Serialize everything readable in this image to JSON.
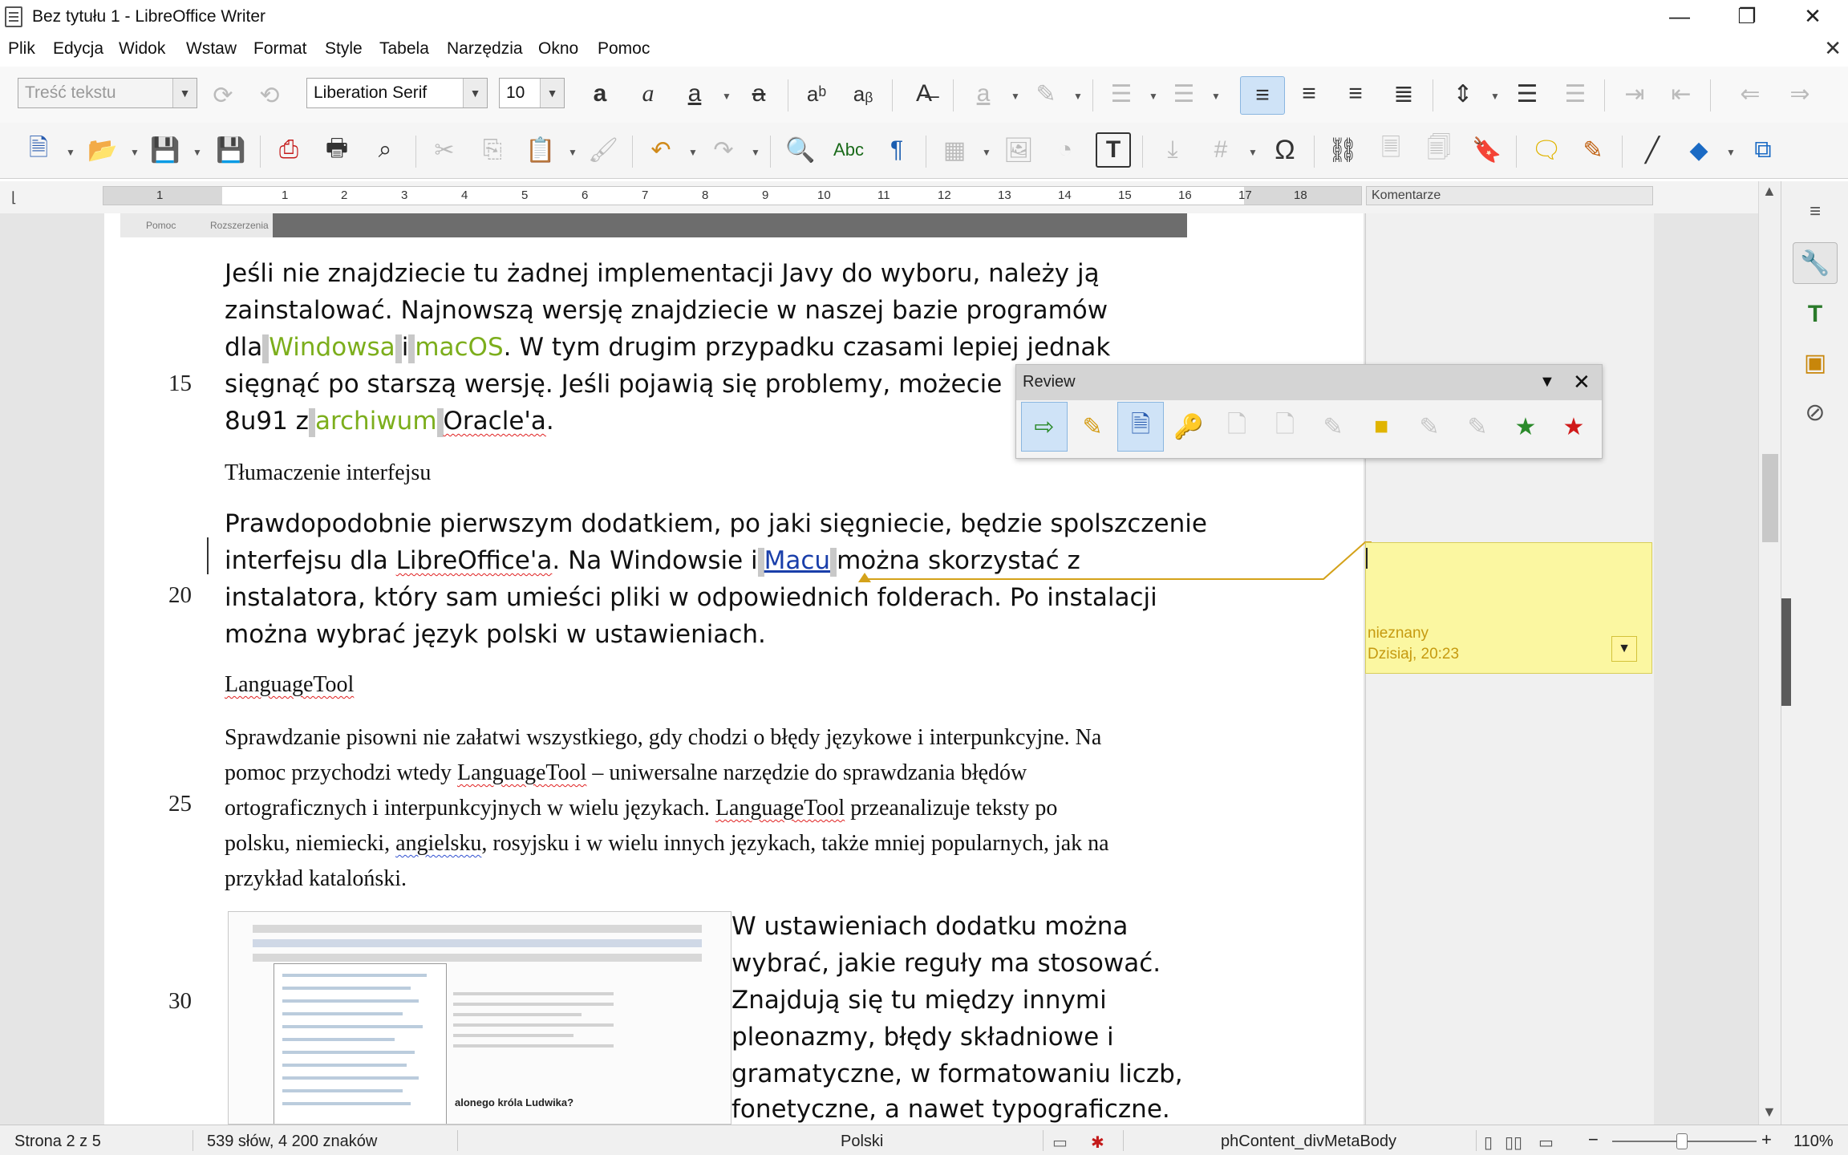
{
  "window": {
    "title": "Bez tytułu 1 - LibreOffice Writer",
    "minimize": "—",
    "restore": "❐",
    "close": "✕"
  },
  "menu": {
    "items": [
      "Plik",
      "Edycja",
      "Widok",
      "Wstaw",
      "Format",
      "Style",
      "Tabela",
      "Narzędzia",
      "Okno",
      "Pomoc"
    ],
    "close_doc": "✕"
  },
  "formatting_toolbar": {
    "paragraph_style": "Treść tekstu",
    "font_name": "Liberation Serif",
    "font_size": "10"
  },
  "ruler": {
    "numbers": [
      "1",
      "1",
      "2",
      "3",
      "4",
      "5",
      "6",
      "7",
      "8",
      "9",
      "10",
      "11",
      "12",
      "13",
      "14",
      "15",
      "16",
      "17",
      "18"
    ],
    "comments_header": "Komentarze"
  },
  "embedded_strip": {
    "tabs": [
      "Pomoc",
      "Rozszerzenia"
    ]
  },
  "document": {
    "line_numbers": [
      "15",
      "20",
      "25",
      "30"
    ],
    "para1": {
      "line1": "Jeśli nie znajdziecie tu żadnej implementacji Javy do wyboru, należy ją",
      "line2": "zainstalować. Najnowszą wersję znajdziecie w naszej bazie programów",
      "line3_a": "dla",
      "line3_link1": "Windowsa",
      "line3_b": "i",
      "line3_link2": "macOS",
      "line3_c": ". W tym drugim przypadku czasami lepiej jednak",
      "line4": "sięgnąć po starszą wersję. Jeśli pojawią się problemy, możecie",
      "line5_a": "8u91 z",
      "line5_link": "archiwum",
      "line5_b": "Oracle'a",
      "line5_c": "."
    },
    "heading1": "Tłumaczenie interfejsu",
    "para2": {
      "line1": "Prawdopodobnie pierwszym dodatkiem, po jaki sięgniecie, będzie spolszczenie",
      "line2_a": "interfejsu dla",
      "line2_spell": "LibreOffice'a",
      "line2_b": ". Na Windowsie i",
      "line2_link": "Macu",
      "line2_c": "można skorzystać z",
      "line3": "instalatora, który sam umieści pliki w odpowiednich folderach. Po instalacji",
      "line4": "można wybrać język polski w ustawieniach."
    },
    "heading2": "LanguageTool",
    "para3": {
      "line1": "Sprawdzanie pisowni nie załatwi wszystkiego, gdy chodzi o błędy językowe i interpunkcyjne. Na",
      "line2_a": "pomoc przychodzi wtedy",
      "line2_spell": "LanguageTool",
      "line2_b": "– uniwersalne narzędzie do sprawdzania błędów",
      "line3_a": "ortograficznych i interpunkcyjnych w wielu językach.",
      "line3_spell": "LanguageTool",
      "line3_b": "przeanalizuje teksty po",
      "line4_a": "polsku, niemiecki,",
      "line4_spell": "angielsku",
      "line4_b": ", rosyjsku i w wielu innych językach, także mniej popularnych, jak na",
      "line5": "przykład kataloński."
    },
    "para4": [
      "W ustawieniach dodatku można",
      "wybrać, jakie reguły ma stosować.",
      "Znajdują się tu między innymi",
      "pleonazmy, błędy składniowe i",
      "gramatyczne, w formatowaniu liczb,",
      "fonetyczne, a nawet typograficzne."
    ],
    "image_caption": "alonego króla Ludwika?"
  },
  "comment": {
    "author": "nieznany",
    "date": "Dzisiaj, 20:23",
    "menu_icon": "chevron-down-icon"
  },
  "review_toolbar": {
    "title": "Review",
    "icons": [
      "track-changes-icon",
      "record-icon",
      "show-changes-icon",
      "manage-icon",
      "previous-change-icon",
      "next-change-icon",
      "accept-icon",
      "comment-icon",
      "delete-comments-icon",
      "delete-all-icon",
      "compare-icon",
      "merge-icon"
    ]
  },
  "status": {
    "page": "Strona 2 z 5",
    "words": "539 słów, 4 200 znaków",
    "language": "Polski",
    "style": "phContent_divMetaBody",
    "zoom": "110%",
    "zoom_minus": "−",
    "zoom_plus": "+"
  },
  "colors": {
    "accent_hyperlink": "#7cae1c",
    "comment_bg": "#fbf7a1",
    "comment_text": "#c69a10",
    "highlight": "#cfe3f7"
  }
}
